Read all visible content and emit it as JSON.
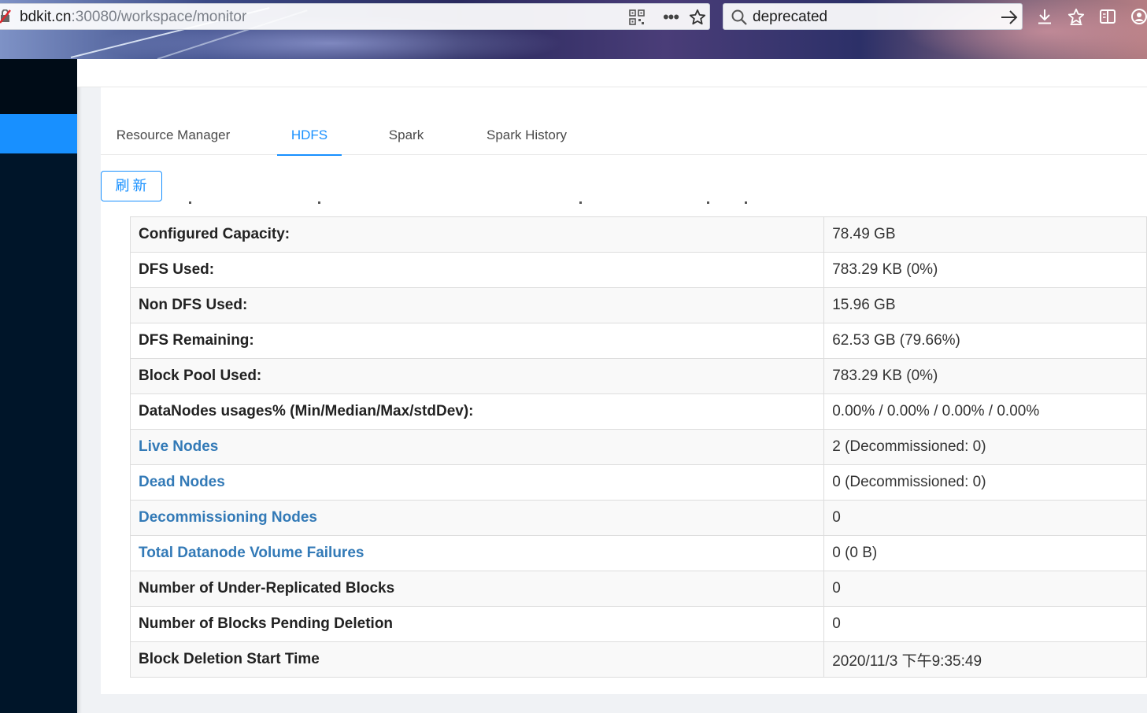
{
  "browser": {
    "url_host": "bdkit.cn",
    "url_path": ":30080/workspace/monitor",
    "search_query": "deprecated"
  },
  "tabs": [
    {
      "label": "Resource Manager",
      "active": false
    },
    {
      "label": "HDFS",
      "active": true
    },
    {
      "label": "Spark",
      "active": false
    },
    {
      "label": "Spark History",
      "active": false
    }
  ],
  "refresh_label": "刷新",
  "rows": [
    {
      "key": "Configured Capacity:",
      "value": "78.49 GB",
      "link": false
    },
    {
      "key": "DFS Used:",
      "value": "783.29 KB (0%)",
      "link": false
    },
    {
      "key": "Non DFS Used:",
      "value": "15.96 GB",
      "link": false
    },
    {
      "key": "DFS Remaining:",
      "value": "62.53 GB (79.66%)",
      "link": false
    },
    {
      "key": "Block Pool Used:",
      "value": "783.29 KB (0%)",
      "link": false
    },
    {
      "key": "DataNodes usages% (Min/Median/Max/stdDev):",
      "value": "0.00% / 0.00% / 0.00% / 0.00%",
      "link": false
    },
    {
      "key": "Live Nodes",
      "value": "2 (Decommissioned: 0)",
      "link": true
    },
    {
      "key": "Dead Nodes",
      "value": "0 (Decommissioned: 0)",
      "link": true
    },
    {
      "key": "Decommissioning Nodes",
      "value": "0",
      "link": true
    },
    {
      "key": "Total Datanode Volume Failures",
      "value": "0 (0 B)",
      "link": true
    },
    {
      "key": "Number of Under-Replicated Blocks",
      "value": "0",
      "link": false
    },
    {
      "key": "Number of Blocks Pending Deletion",
      "value": "0",
      "link": false
    },
    {
      "key": "Block Deletion Start Time",
      "value": "2020/11/3 下午9:35:49",
      "link": false
    }
  ],
  "colors": {
    "accent": "#1890ff",
    "link": "#337ab7",
    "nav_bg": "#001529"
  }
}
